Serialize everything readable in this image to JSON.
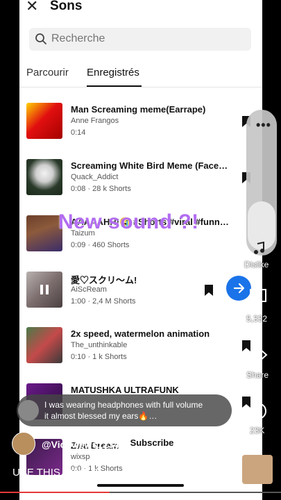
{
  "header": {
    "title": "Sons",
    "close_icon": "close-icon"
  },
  "search": {
    "placeholder": "Recherche",
    "icon": "search-icon"
  },
  "tabs": [
    {
      "label": "Parcourir",
      "active": false
    },
    {
      "label": "Enregistrés",
      "active": true
    }
  ],
  "sounds": [
    {
      "title": "Man Screaming meme(Earrape)",
      "author": "Anne Frangos",
      "meta": "0:14"
    },
    {
      "title": "Screaming White Bird Meme (Face…",
      "author": "Quack_Addict",
      "meta": "0:08 · 28 k Shorts"
    },
    {
      "title": "AAAAAHH!😭 #Shorts #viral #funn…",
      "author": "Taizum",
      "meta": "0:09 · 460 Shorts"
    },
    {
      "title": "愛♡スクリ～ム!",
      "author": "AiScReam",
      "meta": "1:00 · 2,4 M Shorts",
      "playing": true
    },
    {
      "title": "2x speed, watermelon animation",
      "author": "The_unthinkable",
      "meta": "0:10 · 1 k Shorts"
    },
    {
      "title": "MATUSHKA ULTRAFUNK",
      "author": "",
      "meta": ""
    },
    {
      "title": "Zwa Dream",
      "author": "wixsp",
      "meta": "0:0 · 1 k Shorts"
    }
  ],
  "overlay_text": "New sound ?!",
  "side_actions": {
    "dislike": "Dislike",
    "comments": "5,332",
    "share": "Share",
    "remix": "23K"
  },
  "comment": {
    "text": "I was wearing headphones with full volume it almost blessed my ears🔥…"
  },
  "channel": {
    "name": "@Vic_views1234",
    "subscribe": "Subscribe"
  },
  "use_sound": "USE THIS SOUND",
  "progress_fraction": 0.39,
  "colors": {
    "accent": "#1a73e8",
    "overlay": "#b26cf0",
    "progress": "#e53935"
  }
}
